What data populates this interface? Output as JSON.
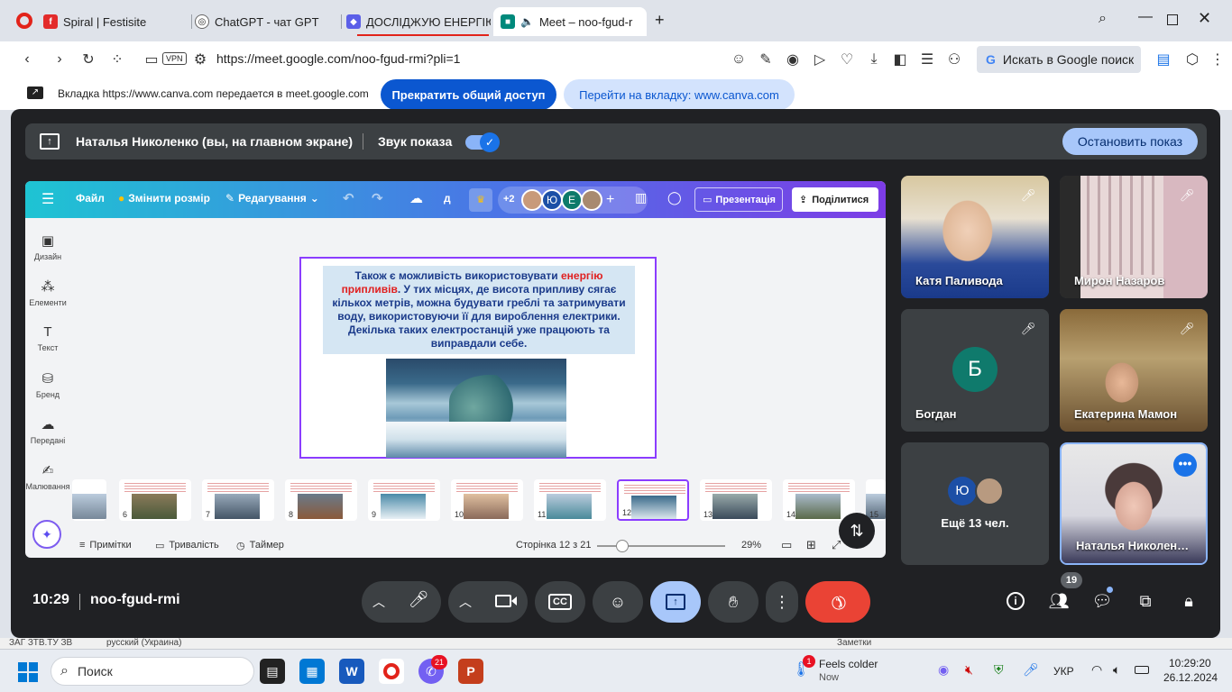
{
  "browser": {
    "tabs": [
      {
        "label": "Spiral | Festisite",
        "color": "#e32b2b",
        "glyph": "f"
      },
      {
        "label": "ChatGPT - чат GPT",
        "color": "#222222",
        "glyph": "◎"
      },
      {
        "label": "ДОСЛІДЖУЮ ЕНЕРГІЮ В",
        "color": "#5b5fe8",
        "glyph": "◆"
      },
      {
        "label": "Meet – noo-fgud-r",
        "color": "#00897b",
        "glyph": "■"
      }
    ],
    "url": "https://meet.google.com/noo-fgud-rmi?pli=1",
    "vpn_label": "VPN",
    "search_label": "Искать в Google поиск"
  },
  "sharebar": {
    "text": "Вкладка https://www.canva.com передается в meet.google.com",
    "stop_label": "Прекратить общий доступ",
    "goto_label": "Перейти на вкладку: www.canva.com"
  },
  "meet": {
    "presenter_label": "Наталья Николенко (вы, на главном экране)",
    "sound_label": "Звук показа",
    "stop_show_label": "Остановить показ",
    "time": "10:29",
    "meeting_code": "noo-fgud-rmi",
    "participants_count": "19",
    "participants": [
      {
        "name": "Катя Паливода",
        "muted": true
      },
      {
        "name": "Мирон Назаров",
        "muted": true
      },
      {
        "name": "Богдан",
        "initial": "Б",
        "muted": true
      },
      {
        "name": "Екатерина Мамон",
        "muted": true
      },
      {
        "name": "Ещё 13 чел.",
        "initial": "Ю"
      },
      {
        "name": "Наталья Николен…"
      }
    ]
  },
  "canva": {
    "file_label": "Файл",
    "resize_label": "Змінити розмір",
    "edit_label": "Редагування",
    "d_label": "д",
    "plus_label": "+2",
    "avatar_yu": "Ю",
    "avatar_e": "Е",
    "present_label": "Презентація",
    "share_label": "Поділитися",
    "sidebar": [
      "Дизайн",
      "Елементи",
      "Текст",
      "Бренд",
      "Передані",
      "Малювання"
    ],
    "slide": {
      "text_before": "Також є можливість використовувати ",
      "text_highlight": "енергію припливів",
      "text_after": ". У тих місцях, де висота припливу сягає кількох метрів, можна будувати греблі та затримувати воду, використовуючи її для вироблення електрики. Декілька таких електростанцій уже працюють та виправдали себе."
    },
    "thumbnails": [
      "",
      "6",
      "7",
      "8",
      "9",
      "10",
      "11",
      "12",
      "13",
      "14",
      "15"
    ],
    "notes_label": "Примітки",
    "duration_label": "Тривалість",
    "timer_label": "Таймер",
    "page_label": "Сторінка 12 з 21",
    "zoom": "29%",
    "zoom_fraction": 0.2
  },
  "below": {
    "left": "ЗАГ ЗТВ.ТУ ЗВ",
    "mid": "русский (Украина)",
    "right": "Заметки"
  },
  "taskbar": {
    "search_label": "Поиск",
    "weather_title": "Feels colder",
    "weather_sub": "Now",
    "weather_badge": "1",
    "viber_badge": "21",
    "lang": "УКР",
    "time": "10:29:20",
    "date": "26.12.2024"
  },
  "colors": {
    "canva_purple": "#8b3dff",
    "meet_bg": "#202124",
    "end_call": "#ea4335",
    "present_blue": "#a8c7fa"
  }
}
